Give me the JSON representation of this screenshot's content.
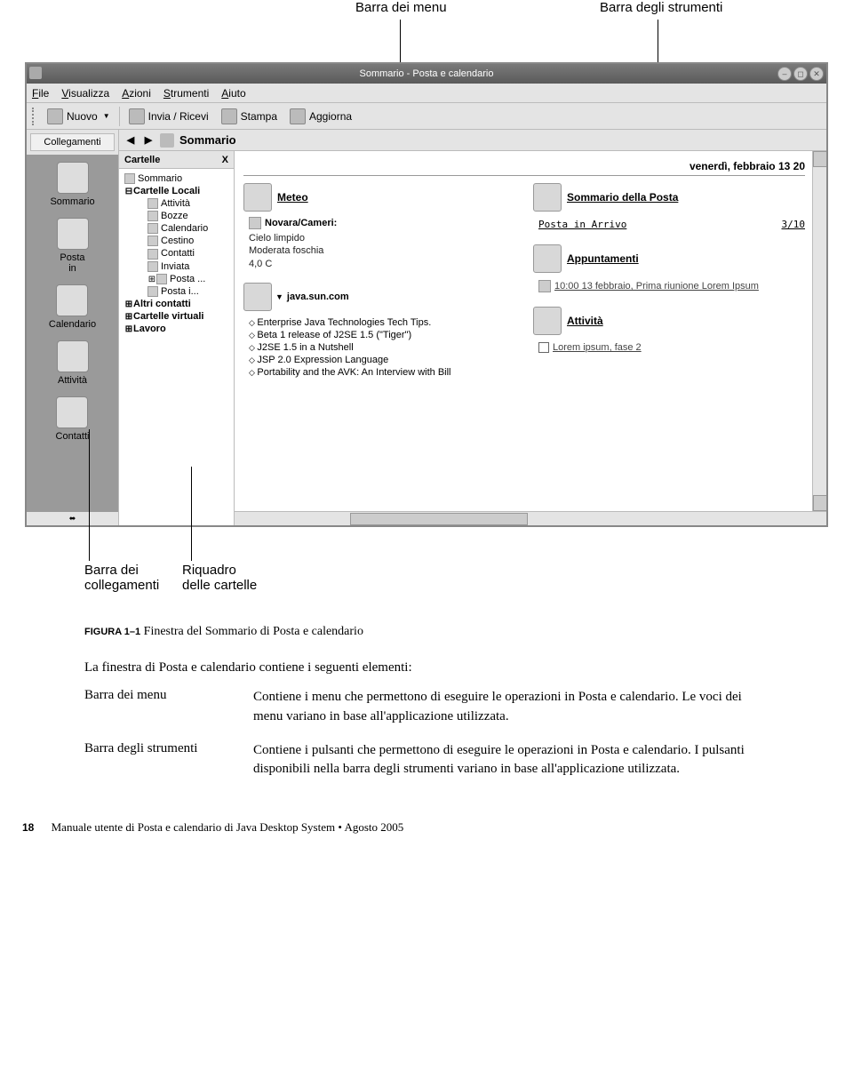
{
  "annotations": {
    "top_menu": "Barra  dei menu",
    "top_tools": "Barra degli strumenti",
    "bottom_shortcuts": "Barra dei\ncollegamenti",
    "bottom_folders": "Riquadro\ndelle cartelle"
  },
  "window": {
    "title": "Sommario - Posta e calendario"
  },
  "menubar": {
    "items": [
      "File",
      "Visualizza",
      "Azioni",
      "Strumenti",
      "Aiuto"
    ]
  },
  "toolbar": {
    "new": "Nuovo",
    "send": "Invia / Ricevi",
    "print": "Stampa",
    "refresh": "Aggiorna"
  },
  "shortcuts": {
    "title": "Collegamenti",
    "items": [
      {
        "label": "Sommario"
      },
      {
        "label": "Posta\nin"
      },
      {
        "label": "Calendario"
      },
      {
        "label": "Attività"
      },
      {
        "label": "Contatti"
      }
    ]
  },
  "location": {
    "current": "Sommario"
  },
  "folders": {
    "title": "Cartelle",
    "close": "X",
    "tree": [
      {
        "label": "Sommario",
        "indent": 0,
        "icon": true
      },
      {
        "label": "Cartelle Locali",
        "indent": 0,
        "bold": true,
        "expander": "⊟"
      },
      {
        "label": "Attività",
        "indent": 2,
        "icon": true
      },
      {
        "label": "Bozze",
        "indent": 2,
        "icon": true
      },
      {
        "label": "Calendario",
        "indent": 2,
        "icon": true
      },
      {
        "label": "Cestino",
        "indent": 2,
        "icon": true
      },
      {
        "label": "Contatti",
        "indent": 2,
        "icon": true
      },
      {
        "label": "Inviata",
        "indent": 2,
        "icon": true
      },
      {
        "label": "Posta ...",
        "indent": 2,
        "icon": true,
        "expander": "⊞"
      },
      {
        "label": "Posta i...",
        "indent": 2,
        "icon": true
      },
      {
        "label": "Altri contatti",
        "indent": 0,
        "bold": true,
        "expander": "⊞"
      },
      {
        "label": "Cartelle virtuali",
        "indent": 0,
        "bold": true,
        "expander": "⊞"
      },
      {
        "label": "Lavoro",
        "indent": 0,
        "bold": true,
        "expander": "⊞"
      }
    ]
  },
  "summary": {
    "date": "venerdì, febbraio 13 20",
    "weather": {
      "title": "Meteo",
      "location": "Novara/Cameri:",
      "line1": "Cielo limpido",
      "line2": "Moderata foschia",
      "line3": "4,0 C"
    },
    "news": {
      "source": "java.sun.com",
      "items": [
        "Enterprise Java Technologies Tech Tips.",
        "Beta 1 release of J2SE 1.5 (\"Tiger\")",
        "J2SE 1.5 in a Nutshell",
        "JSP 2.0 Expression Language",
        "Portability and the AVK: An Interview with Bill"
      ]
    },
    "mail": {
      "title": "Sommario della Posta",
      "inbox": "Posta in Arrivo",
      "count": "3/10"
    },
    "appointments": {
      "title": "Appuntamenti",
      "item": "10:00 13 febbraio, Prima riunione Lorem Ipsum"
    },
    "tasks": {
      "title": "Attività",
      "item": "Lorem ipsum, fase 2"
    }
  },
  "document": {
    "figure_label": "FIGURA 1–1",
    "figure_title": "Finestra del Sommario di Posta e calendario",
    "intro": "La finestra di Posta e calendario contiene i seguenti elementi:",
    "rows": [
      {
        "term": "Barra dei menu",
        "desc": "Contiene i menu che permettono di eseguire le operazioni in Posta e calendario. Le voci dei menu variano in base all'applicazione utilizzata."
      },
      {
        "term": "Barra degli strumenti",
        "desc": "Contiene i pulsanti che permettono di eseguire le operazioni in Posta e calendario. I pulsanti disponibili nella barra degli strumenti variano in base all'applicazione utilizzata."
      }
    ],
    "page_num": "18",
    "footer": "Manuale utente di Posta e calendario di Java Desktop System • Agosto 2005"
  }
}
